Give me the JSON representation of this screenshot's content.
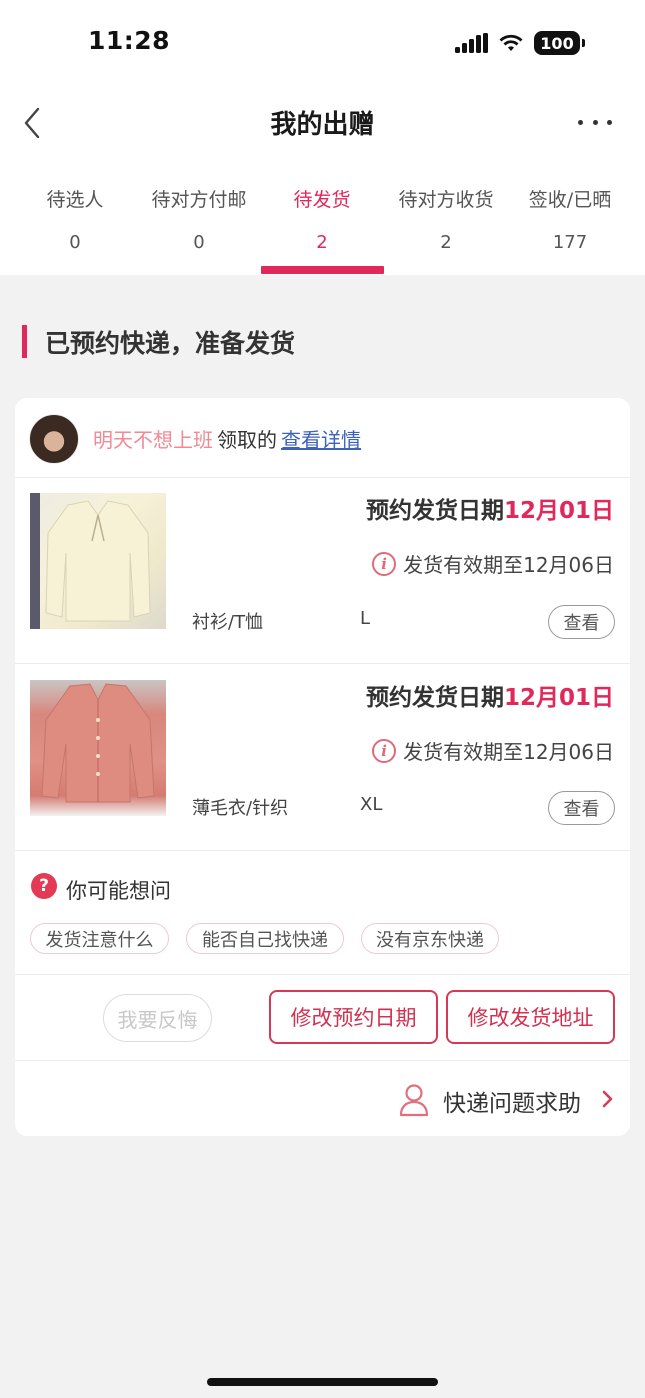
{
  "status_bar": {
    "time": "11:28",
    "battery": "100"
  },
  "nav": {
    "title": "我的出赠"
  },
  "tabs": [
    {
      "label": "待选人",
      "count": "0"
    },
    {
      "label": "待对方付邮",
      "count": "0"
    },
    {
      "label": "待发货",
      "count": "2"
    },
    {
      "label": "待对方收货",
      "count": "2"
    },
    {
      "label": "签收/已晒",
      "count": "177"
    }
  ],
  "active_tab": "待发货",
  "section": {
    "title": "已预约快递，准备发货"
  },
  "order": {
    "claimer_name": "明天不想上班",
    "claimer_text": "领取的",
    "detail_link": "查看详情",
    "items": [
      {
        "schedule_label": "预约发货日期",
        "schedule_date": "12月01日",
        "validity": "发货有效期至12月06日",
        "category": "衬衫/T恤",
        "size": "L",
        "view_label": "查看"
      },
      {
        "schedule_label": "预约发货日期",
        "schedule_date": "12月01日",
        "validity": "发货有效期至12月06日",
        "category": "薄毛衣/针织",
        "size": "XL",
        "view_label": "查看"
      }
    ],
    "faq": {
      "title": "你可能想问",
      "chips": [
        "发货注意什么",
        "能否自己找快递",
        "没有京东快递"
      ]
    },
    "actions": {
      "regret": "我要反悔",
      "change_date": "修改预约日期",
      "change_address": "修改发货地址"
    },
    "help": {
      "label": "快递问题求助"
    }
  },
  "colors": {
    "accent": "#e0285a",
    "link": "#3d63b8",
    "claimer": "#ef8a96",
    "background": "#f2f2f3"
  }
}
